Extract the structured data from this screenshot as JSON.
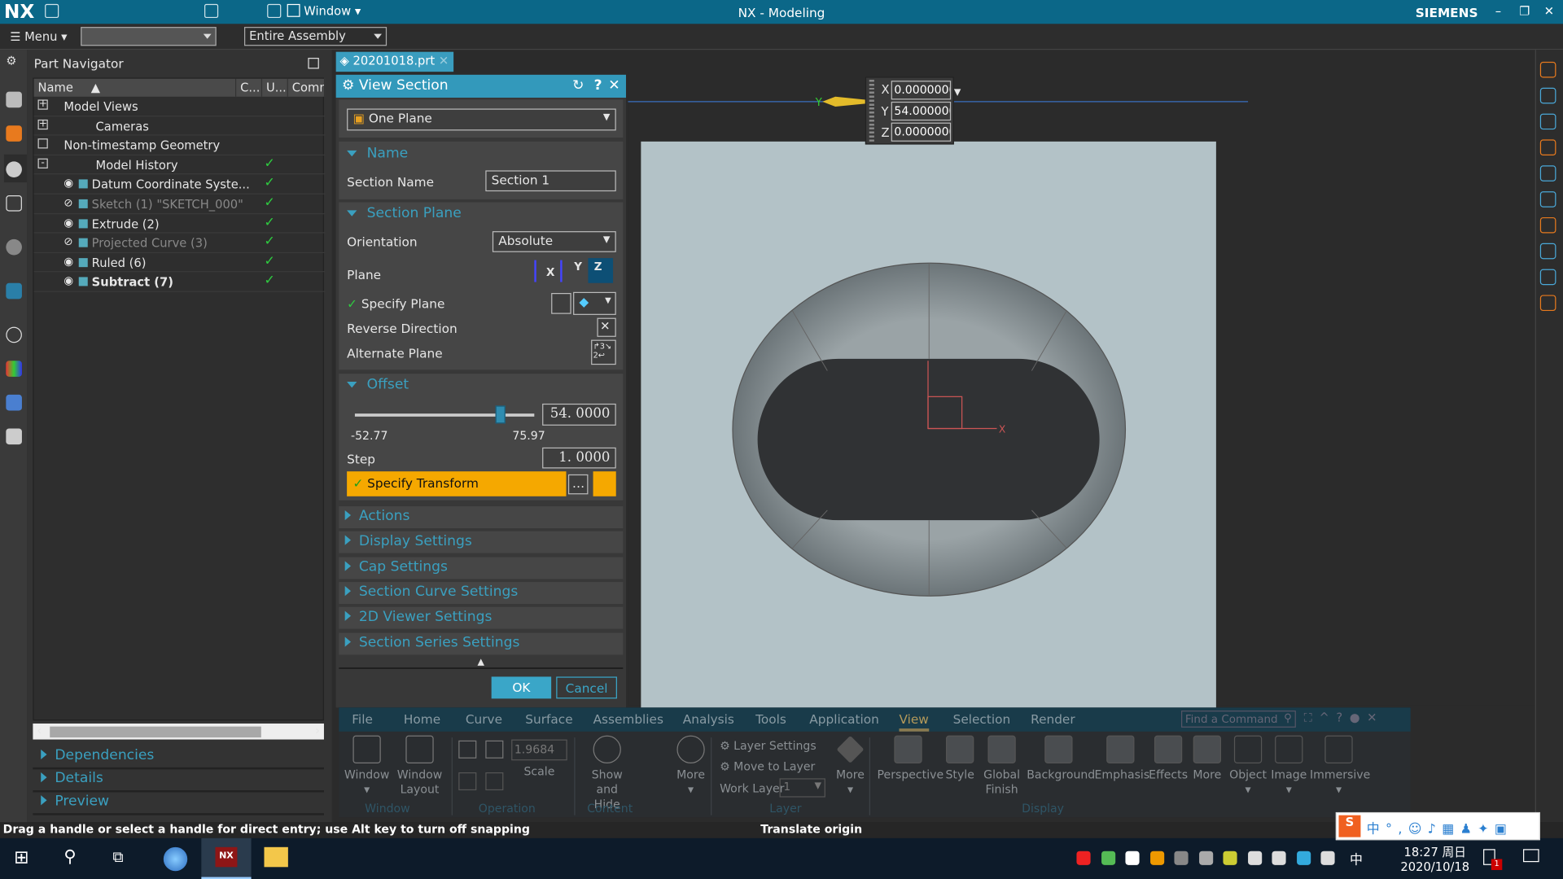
{
  "app": {
    "logo": "NX",
    "title": "NX - Modeling",
    "brand": "SIEMENS",
    "window_menu": "Window"
  },
  "toolbar": {
    "menu": "Menu",
    "filter_value": "",
    "scope": "Entire Assembly"
  },
  "file_tab": {
    "name": "20201018.prt"
  },
  "part_navigator": {
    "title": "Part Navigator",
    "columns": [
      "Name",
      "C...",
      "U...",
      "Comm"
    ],
    "rows": [
      {
        "label": "Model Views",
        "level": 0,
        "expander": "+",
        "state": "normal",
        "uptodate": false
      },
      {
        "label": "Cameras",
        "level": 0,
        "expander": "+",
        "state": "normal",
        "uptodate": false
      },
      {
        "label": "Non-timestamp Geometry",
        "level": 0,
        "expander": "",
        "state": "normal",
        "uptodate": false
      },
      {
        "label": "Model History",
        "level": 0,
        "expander": "-",
        "state": "normal",
        "uptodate": true
      },
      {
        "label": "Datum Coordinate Syste...",
        "level": 1,
        "state": "normal",
        "uptodate": true
      },
      {
        "label": "Sketch (1) \"SKETCH_000\"",
        "level": 1,
        "state": "hidden",
        "uptodate": true
      },
      {
        "label": "Extrude (2)",
        "level": 1,
        "state": "normal",
        "uptodate": true
      },
      {
        "label": "Projected Curve (3)",
        "level": 1,
        "state": "hidden",
        "uptodate": true
      },
      {
        "label": "Ruled (6)",
        "level": 1,
        "state": "normal",
        "uptodate": true
      },
      {
        "label": "Subtract (7)",
        "level": 1,
        "state": "current",
        "uptodate": true
      }
    ],
    "panels": [
      "Dependencies",
      "Details",
      "Preview"
    ]
  },
  "dialog": {
    "title": "View Section",
    "type": "One Plane",
    "name_section": {
      "title": "Name",
      "section_name_label": "Section Name",
      "section_name_value": "Section 1"
    },
    "plane_section": {
      "title": "Section Plane",
      "orientation_label": "Orientation",
      "orientation_value": "Absolute",
      "plane_label": "Plane",
      "plane_options": [
        "X",
        "Y",
        "Z"
      ],
      "plane_selected": "Z",
      "specify_plane": "Specify Plane",
      "reverse_direction": "Reverse Direction",
      "alternate_plane": "Alternate Plane"
    },
    "offset_section": {
      "title": "Offset",
      "value": "54. 0000",
      "min": "-52.77",
      "max": "75.97",
      "step_label": "Step",
      "step_value": "1. 0000",
      "specify_transform": "Specify Transform"
    },
    "collapsed_groups": [
      "Actions",
      "Display Settings",
      "Cap Settings",
      "Section Curve Settings",
      "2D Viewer Settings",
      "Section Series Settings"
    ],
    "ok": "OK",
    "cancel": "Cancel"
  },
  "coords": {
    "x_label": "X",
    "x": "0.0000000",
    "y_label": "Y",
    "y": "54.000000",
    "z_label": "Z",
    "z": "0.0000000"
  },
  "viewport": {
    "axis_y": "Y",
    "axis_x": "X"
  },
  "ribbon": {
    "tabs": [
      "File",
      "Home",
      "Curve",
      "Surface",
      "Assemblies",
      "Analysis",
      "Tools",
      "Application",
      "View",
      "Selection",
      "Render"
    ],
    "active_tab": "View",
    "search_placeholder": "Find a Command",
    "window_group": {
      "label": "Window",
      "buttons": [
        "Window",
        "Window Layout"
      ]
    },
    "operation_group": {
      "label": "Operation",
      "scale_value": "1.9684",
      "scale_label": "Scale"
    },
    "content_group": {
      "label": "Content",
      "buttons": [
        "Show and Hide",
        "More"
      ]
    },
    "layer_group": {
      "label": "Layer",
      "layer_settings": "Layer Settings",
      "move_to_layer": "Move to Layer",
      "work_layer_label": "Work Layer",
      "work_layer_value": "1",
      "more": "More"
    },
    "display_group": {
      "label": "Display",
      "buttons": [
        "Perspective",
        "Style",
        "Global Finish",
        "Background",
        "Emphasis",
        "Effects",
        "More"
      ]
    },
    "extra_buttons": [
      "Object",
      "Image",
      "Immersive"
    ]
  },
  "status": {
    "left": "Drag a handle or select a handle for direct entry; use Alt key to turn off snapping",
    "center": "Translate origin"
  },
  "taskbar": {
    "time": "18:27 周日",
    "date": "2020/10/18",
    "ime": "中",
    "notifications": "1"
  },
  "colors": {
    "title_bar": "#0b6788",
    "accent": "#3399bb",
    "highlight": "#f5a800",
    "check": "#2ecc40"
  }
}
